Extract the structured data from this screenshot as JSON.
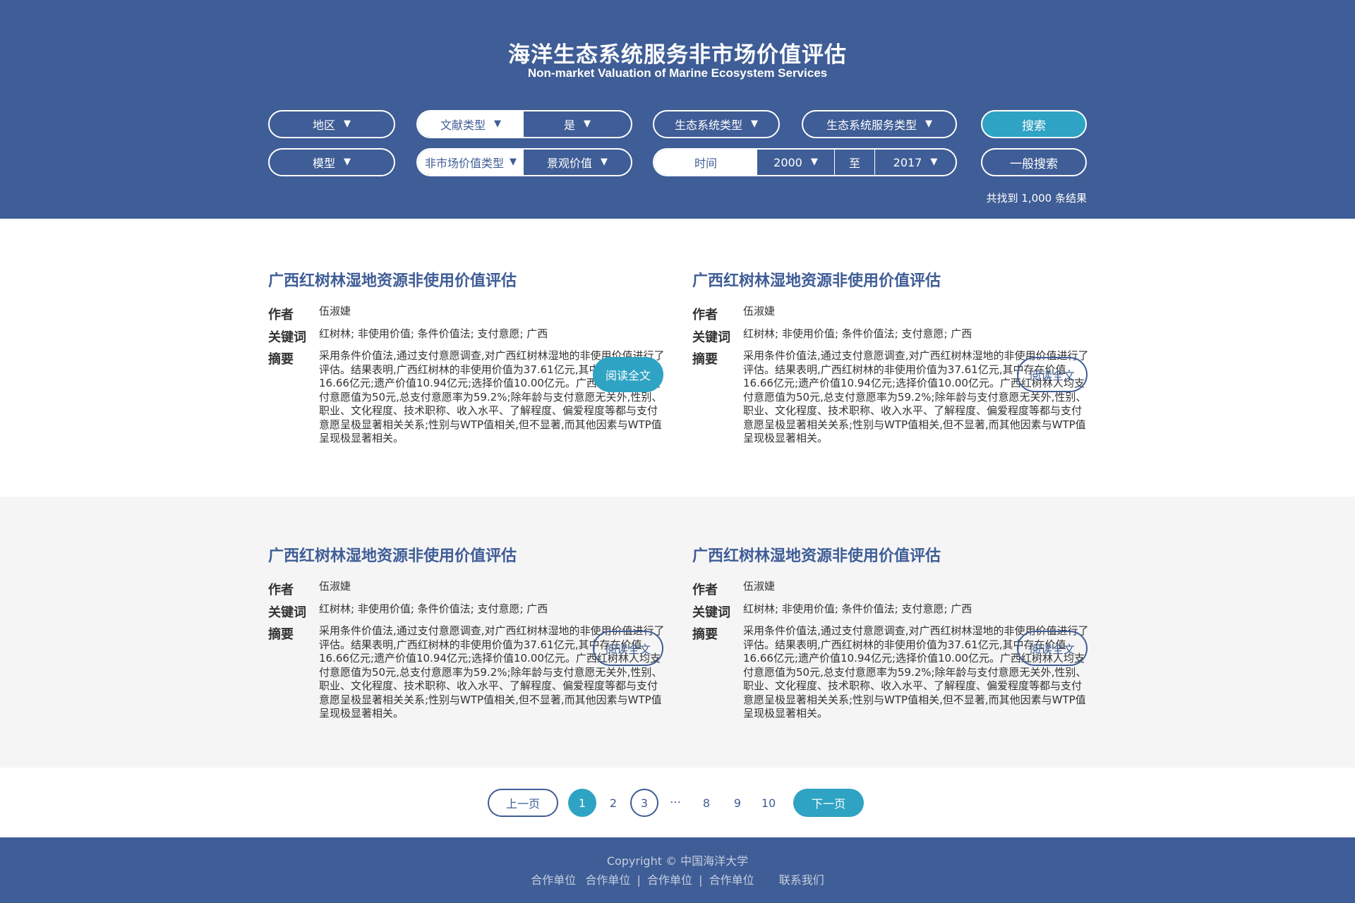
{
  "header": {
    "title_cn": "海洋生态系统服务非市场价值评估",
    "title_en": "Non-market Valuation of Marine Ecosystem Services"
  },
  "filters": {
    "region": "地区",
    "doc_type": "文献类型",
    "doc_type_value": "是",
    "ecosystem_type": "生态系统类型",
    "service_type": "生态系统服务类型",
    "model": "模型",
    "value_type": "非市场价值类型",
    "value_type_value": "景观价值",
    "time_label": "时间",
    "year_from": "2000",
    "to": "至",
    "year_to": "2017",
    "search": "搜索",
    "general_search": "一般搜索"
  },
  "result_count": "共找到 1,000 条结果",
  "labels": {
    "author": "作者",
    "keywords": "关键词",
    "abstract": "摘要",
    "read": "阅读全文"
  },
  "results": [
    {
      "title": "广西红树林湿地资源非使用价值评估",
      "author": "伍淑婕",
      "keywords": "红树林; 非使用价值; 条件价值法; 支付意愿; 广西",
      "abstract": "采用条件价值法,通过支付意愿调查,对广西红树林湿地的非使用价值进行了评估。结果表明,广西红树林的非使用价值为37.61亿元,其中存在价值16.66亿元;遗产价值10.94亿元;选择价值10.00亿元。广西红树林人均支付意愿值为50元,总支付意愿率为59.2%;除年龄与支付意愿无关外,性别、职业、文化程度、技术职称、收入水平、了解程度、偏爱程度等都与支付意愿呈极显著相关关系;性别与WTP值相关,但不显著,而其他因素与WTP值呈现极显著相关。"
    },
    {
      "title": "广西红树林湿地资源非使用价值评估",
      "author": "伍淑婕",
      "keywords": "红树林; 非使用价值; 条件价值法; 支付意愿; 广西",
      "abstract": "采用条件价值法,通过支付意愿调查,对广西红树林湿地的非使用价值进行了评估。结果表明,广西红树林的非使用价值为37.61亿元,其中存在价值16.66亿元;遗产价值10.94亿元;选择价值10.00亿元。广西红树林人均支付意愿值为50元,总支付意愿率为59.2%;除年龄与支付意愿无关外,性别、职业、文化程度、技术职称、收入水平、了解程度、偏爱程度等都与支付意愿呈极显著相关关系;性别与WTP值相关,但不显著,而其他因素与WTP值呈现极显著相关。"
    },
    {
      "title": "广西红树林湿地资源非使用价值评估",
      "author": "伍淑婕",
      "keywords": "红树林; 非使用价值; 条件价值法; 支付意愿; 广西",
      "abstract": "采用条件价值法,通过支付意愿调查,对广西红树林湿地的非使用价值进行了评估。结果表明,广西红树林的非使用价值为37.61亿元,其中存在价值16.66亿元;遗产价值10.94亿元;选择价值10.00亿元。广西红树林人均支付意愿值为50元,总支付意愿率为59.2%;除年龄与支付意愿无关外,性别、职业、文化程度、技术职称、收入水平、了解程度、偏爱程度等都与支付意愿呈极显著相关关系;性别与WTP值相关,但不显著,而其他因素与WTP值呈现极显著相关。"
    },
    {
      "title": "广西红树林湿地资源非使用价值评估",
      "author": "伍淑婕",
      "keywords": "红树林; 非使用价值; 条件价值法; 支付意愿; 广西",
      "abstract": "采用条件价值法,通过支付意愿调查,对广西红树林湿地的非使用价值进行了评估。结果表明,广西红树林的非使用价值为37.61亿元,其中存在价值16.66亿元;遗产价值10.94亿元;选择价值10.00亿元。广西红树林人均支付意愿值为50元,总支付意愿率为59.2%;除年龄与支付意愿无关外,性别、职业、文化程度、技术职称、收入水平、了解程度、偏爱程度等都与支付意愿呈极显著相关关系;性别与WTP值相关,但不显著,而其他因素与WTP值呈现极显著相关。"
    }
  ],
  "pagination": {
    "prev": "上一页",
    "next": "下一页",
    "pages": [
      "1",
      "2",
      "3",
      "…",
      "8",
      "9",
      "10"
    ],
    "current": "1"
  },
  "footer": {
    "copyright": "Copyright © 中国海洋大学",
    "link1": "合作单位",
    "link2": "合作单位",
    "link3": "合作单位",
    "link4": "合作单位",
    "contact": "联系我们",
    "sep": "|"
  },
  "colors": {
    "primary": "#3f5d96",
    "accent": "#2fa3c3"
  },
  "icons": {
    "caret": "caret-down-icon"
  }
}
